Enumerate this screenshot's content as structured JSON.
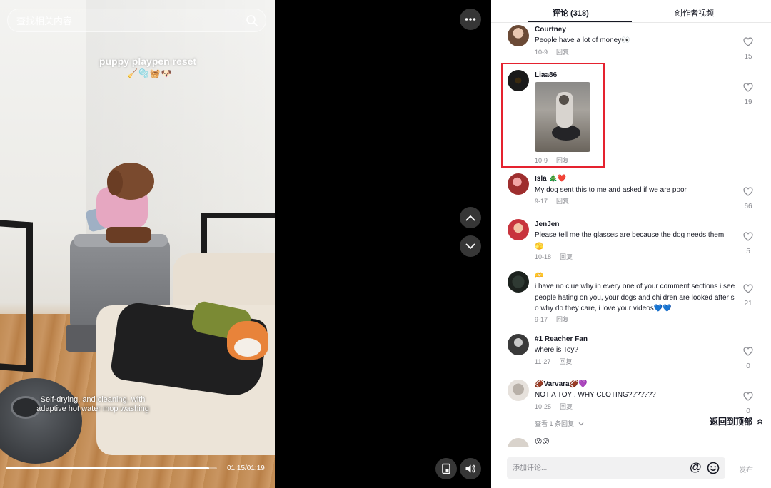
{
  "search": {
    "placeholder": "查找相关内容"
  },
  "video": {
    "title": "puppy playpen reset",
    "title_emoji": "🧹🫧🧺🐶",
    "subtitle": "Self-drying, and cleaning, with adaptive hot water mop washing",
    "time": "01:15/01:19",
    "progress": 0.963
  },
  "tabs": {
    "comments": "评论 (318)",
    "creator_videos": "创作者视频"
  },
  "comments": [
    {
      "name": "Courtney",
      "text": "People have a lot of money👀",
      "date": "10-9",
      "reply": "回复",
      "likes": "15"
    },
    {
      "name": "Liaa86",
      "text": "",
      "date": "10-9",
      "reply": "回复",
      "likes": "19"
    },
    {
      "name": "Isla 🎄❤️",
      "text": "My dog sent this to me and asked if we are poor",
      "date": "9-17",
      "reply": "回复",
      "likes": "66"
    },
    {
      "name": "JenJen",
      "text": "Please tell me the glasses are because the dog needs them. 🫣",
      "date": "10-18",
      "reply": "回复",
      "likes": "5"
    },
    {
      "name": "🫶",
      "text": "i have no clue why in every one of your comment sections i see people hating on you, your dogs and children are looked after so why do they care, i love your videos💙💙",
      "date": "9-17",
      "reply": "回复",
      "likes": "21"
    },
    {
      "name": "#1 Reacher Fan",
      "text": "where is Toy?",
      "date": "11-27",
      "reply": "回复",
      "likes": "0"
    },
    {
      "name": "🏈Varvara🏈💜",
      "text": "NOT A TOY . WHY CLOTING???????",
      "date": "10-25",
      "reply": "回复",
      "likes": "0"
    },
    {
      "name": "😮😮",
      "text": "",
      "date": "",
      "reply": "",
      "likes": ""
    }
  ],
  "view_replies": "查看 1 条回复",
  "back_to_top": "返回到顶部",
  "comment_input": {
    "placeholder": "添加评论..."
  },
  "post_button": "发布",
  "icons": {
    "search": "search-icon",
    "more": "more-icon",
    "up": "chevron-up-icon",
    "down": "chevron-down-icon",
    "pip": "picture-in-picture-icon",
    "volume": "volume-icon",
    "heart": "heart-icon",
    "at": "at-mention-icon",
    "emoji": "emoji-icon",
    "back_top": "double-chevron-up-icon"
  },
  "colors": {
    "highlight": "#e5222f",
    "text": "#161823",
    "muted": "#8a8b91"
  }
}
